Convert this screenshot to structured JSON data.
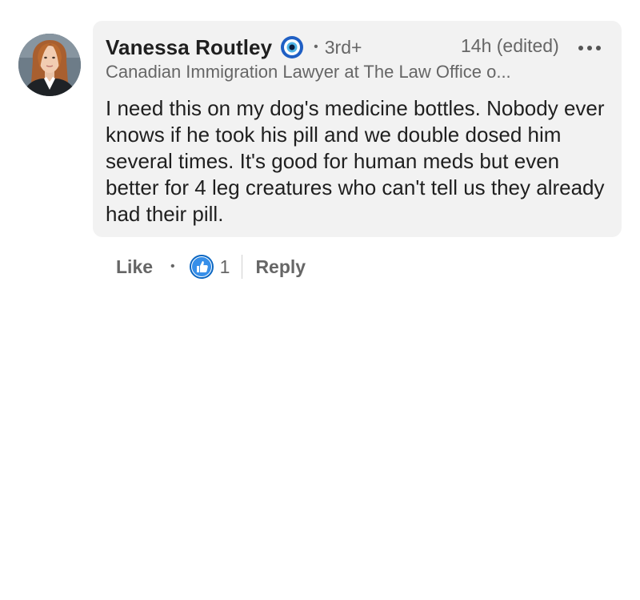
{
  "comment": {
    "author": "Vanessa Routley",
    "badge_icon": "evil-eye-icon",
    "separator": "•",
    "degree": "3rd+",
    "timestamp": "14h (edited)",
    "headline": "Canadian Immigration Lawyer at The Law Office o...",
    "text": "I need this on my dog's medicine bottles. Nobody ever knows if he took his pill and we double dosed him several times. It's good for human meds but even better for 4 leg creatures who can't tell us they already had their pill."
  },
  "actions": {
    "like_label": "Like",
    "separator": "•",
    "like_count": "1",
    "reply_label": "Reply"
  },
  "colors": {
    "bubble_bg": "#f2f2f2",
    "muted_text": "#666666",
    "primary_text": "#1f1f1f",
    "like_blue": "#0a66c2"
  }
}
